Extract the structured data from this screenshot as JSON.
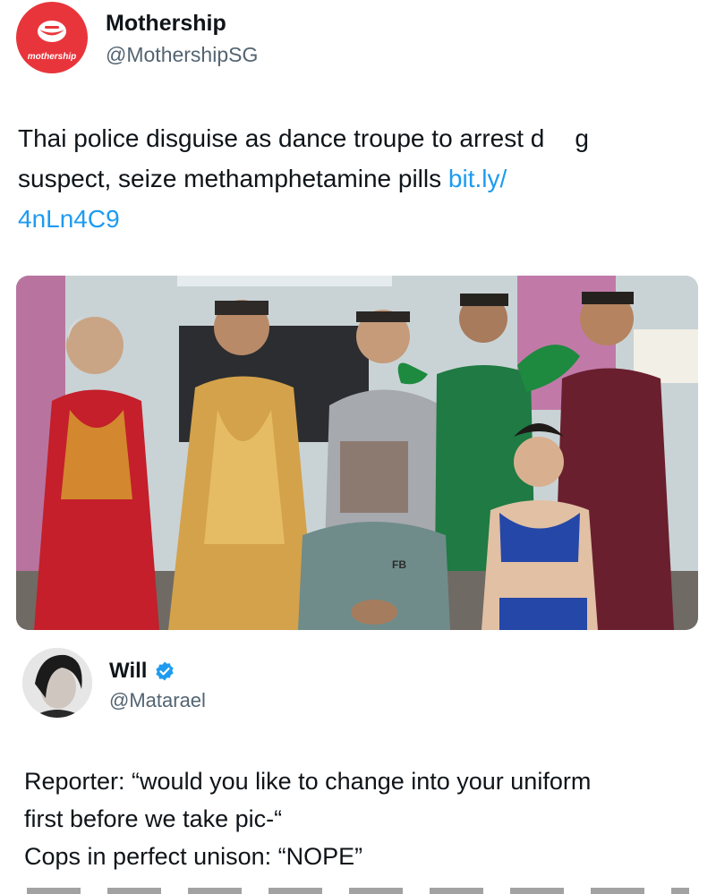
{
  "post": {
    "author": {
      "name": "Mothership",
      "handle": "@MothershipSG",
      "avatar_label": "mothership",
      "brand_color": "#e8353b"
    },
    "text_lines": [
      "Thai police disguise as dance troupe to arrest d",
      "g"
    ],
    "text_line2": "suspect, seize methamphetamine pills ",
    "link_part1": "bit.ly/",
    "link_part2": "4nLn4C9",
    "link_color": "#1d9bf0",
    "photo_shirt_logo": "FB"
  },
  "reply": {
    "author": {
      "name": "Will",
      "handle": "@Matarael",
      "verified_icon": "verified-badge-icon",
      "badge_color": "#1d9bf0"
    },
    "lines": [
      "Reporter: “would you like to change into your uniform",
      "first before we take pic-“",
      "Cops in perfect unison: “NOPE”"
    ]
  }
}
